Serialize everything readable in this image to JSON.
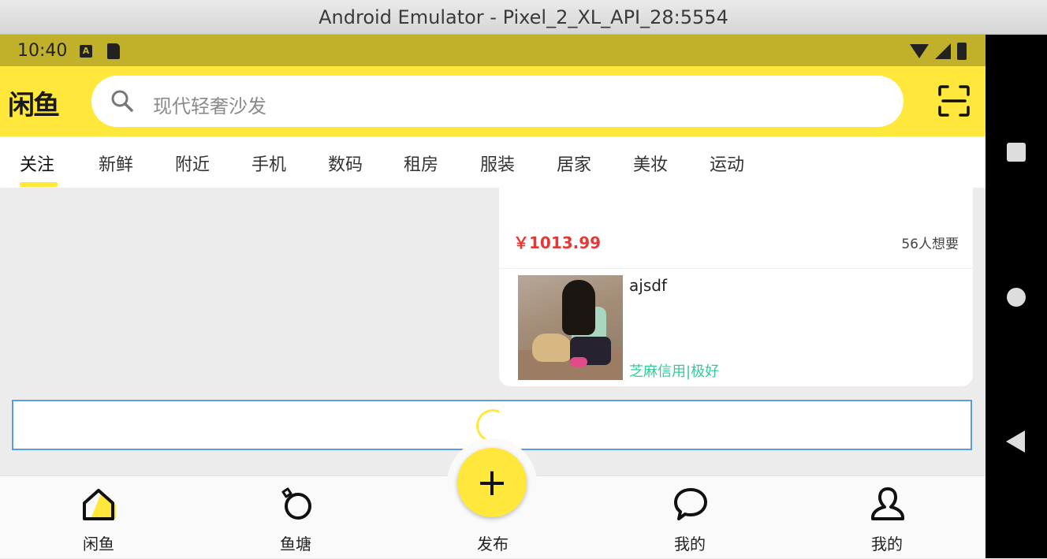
{
  "window": {
    "title": "Android Emulator - Pixel_2_XL_API_28:5554"
  },
  "status_bar": {
    "time": "10:40",
    "icons": [
      "a-notification-icon",
      "sd-card-icon",
      "wifi-icon",
      "signal-icon",
      "battery-icon"
    ]
  },
  "header": {
    "logo": "闲鱼",
    "search_placeholder": "现代轻奢沙发",
    "scan_icon": "scan-icon"
  },
  "tabs": [
    {
      "label": "关注",
      "active": true
    },
    {
      "label": "新鲜"
    },
    {
      "label": "附近"
    },
    {
      "label": "手机"
    },
    {
      "label": "数码"
    },
    {
      "label": "租房"
    },
    {
      "label": "服装"
    },
    {
      "label": "居家"
    },
    {
      "label": "美妆"
    },
    {
      "label": "运动"
    }
  ],
  "card": {
    "price": "￥1013.99",
    "wants": "56人想要",
    "seller_name": "ajsdf",
    "credit": "芝麻信用|极好"
  },
  "bottom_nav": [
    {
      "label": "闲鱼",
      "icon": "home-icon"
    },
    {
      "label": "鱼塘",
      "icon": "ring-icon"
    },
    {
      "label": "发布",
      "icon": "plus-icon"
    },
    {
      "label": "我的",
      "icon": "chat-bubble-icon"
    },
    {
      "label": "我的",
      "icon": "person-icon"
    }
  ],
  "colors": {
    "accent": "#ffe83b",
    "status_bar": "#c1b02a",
    "price": "#e53935",
    "credit": "#33cc99"
  }
}
